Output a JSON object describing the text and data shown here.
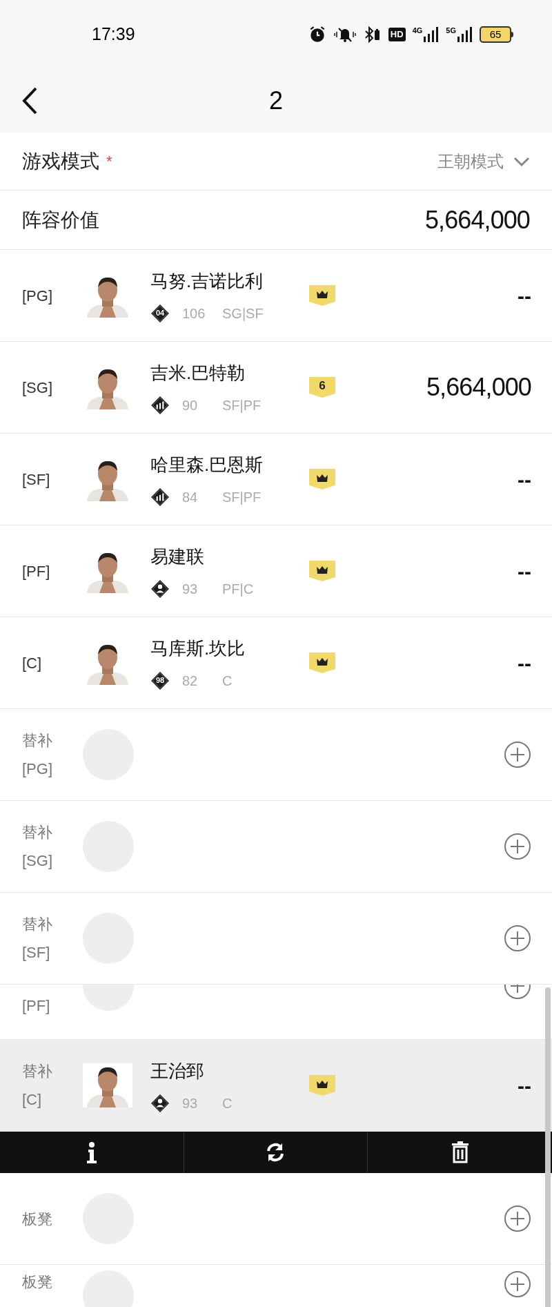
{
  "status_bar": {
    "time": "17:39",
    "hd": "HD",
    "net1": "4G",
    "net2": "5G",
    "battery": "65"
  },
  "header": {
    "title": "2"
  },
  "mode": {
    "label": "游戏模式",
    "required": "*",
    "value": "王朝模式"
  },
  "lineup_value": {
    "label": "阵容价值",
    "value": "5,664,000"
  },
  "rows": [
    {
      "kind": "player",
      "slot": "[PG]",
      "name": "马努.吉诺比利",
      "badge": {
        "kind": "number",
        "text": "04"
      },
      "rating": "106",
      "positions": "SG|SF",
      "tier": {
        "kind": "crown"
      },
      "price": "--",
      "selected": false
    },
    {
      "kind": "player",
      "slot": "[SG]",
      "name": "吉米.巴特勒",
      "badge": {
        "kind": "bars"
      },
      "rating": "90",
      "positions": "SF|PF",
      "tier": {
        "kind": "number",
        "text": "6"
      },
      "price": "5,664,000",
      "selected": false
    },
    {
      "kind": "player",
      "slot": "[SF]",
      "name": "哈里森.巴恩斯",
      "badge": {
        "kind": "bars"
      },
      "rating": "84",
      "positions": "SF|PF",
      "tier": {
        "kind": "crown"
      },
      "price": "--",
      "selected": false
    },
    {
      "kind": "player",
      "slot": "[PF]",
      "name": "易建联",
      "badge": {
        "kind": "person"
      },
      "rating": "93",
      "positions": "PF|C",
      "tier": {
        "kind": "crown"
      },
      "price": "--",
      "selected": false
    },
    {
      "kind": "player",
      "slot": "[C]",
      "name": "马库斯.坎比",
      "badge": {
        "kind": "number",
        "text": "98"
      },
      "rating": "82",
      "positions": "C",
      "tier": {
        "kind": "crown"
      },
      "price": "--",
      "selected": false
    },
    {
      "kind": "empty",
      "role": "替补",
      "slot": "[PG]",
      "selected": false
    },
    {
      "kind": "empty",
      "role": "替补",
      "slot": "[SG]",
      "selected": false
    },
    {
      "kind": "empty",
      "role": "替补",
      "slot": "[SF]",
      "selected": false
    },
    {
      "kind": "partial",
      "slot": "[PF]",
      "selected": false
    },
    {
      "kind": "player",
      "role": "替补",
      "slot": "[C]",
      "name": "王治郅",
      "badge": {
        "kind": "person"
      },
      "rating": "93",
      "positions": "C",
      "tier": {
        "kind": "crown"
      },
      "price": "--",
      "selected": true
    },
    {
      "kind": "actions"
    },
    {
      "kind": "empty",
      "role": "板凳",
      "selected": false
    },
    {
      "kind": "empty",
      "role": "板凳",
      "selected": false,
      "cut": true
    }
  ]
}
